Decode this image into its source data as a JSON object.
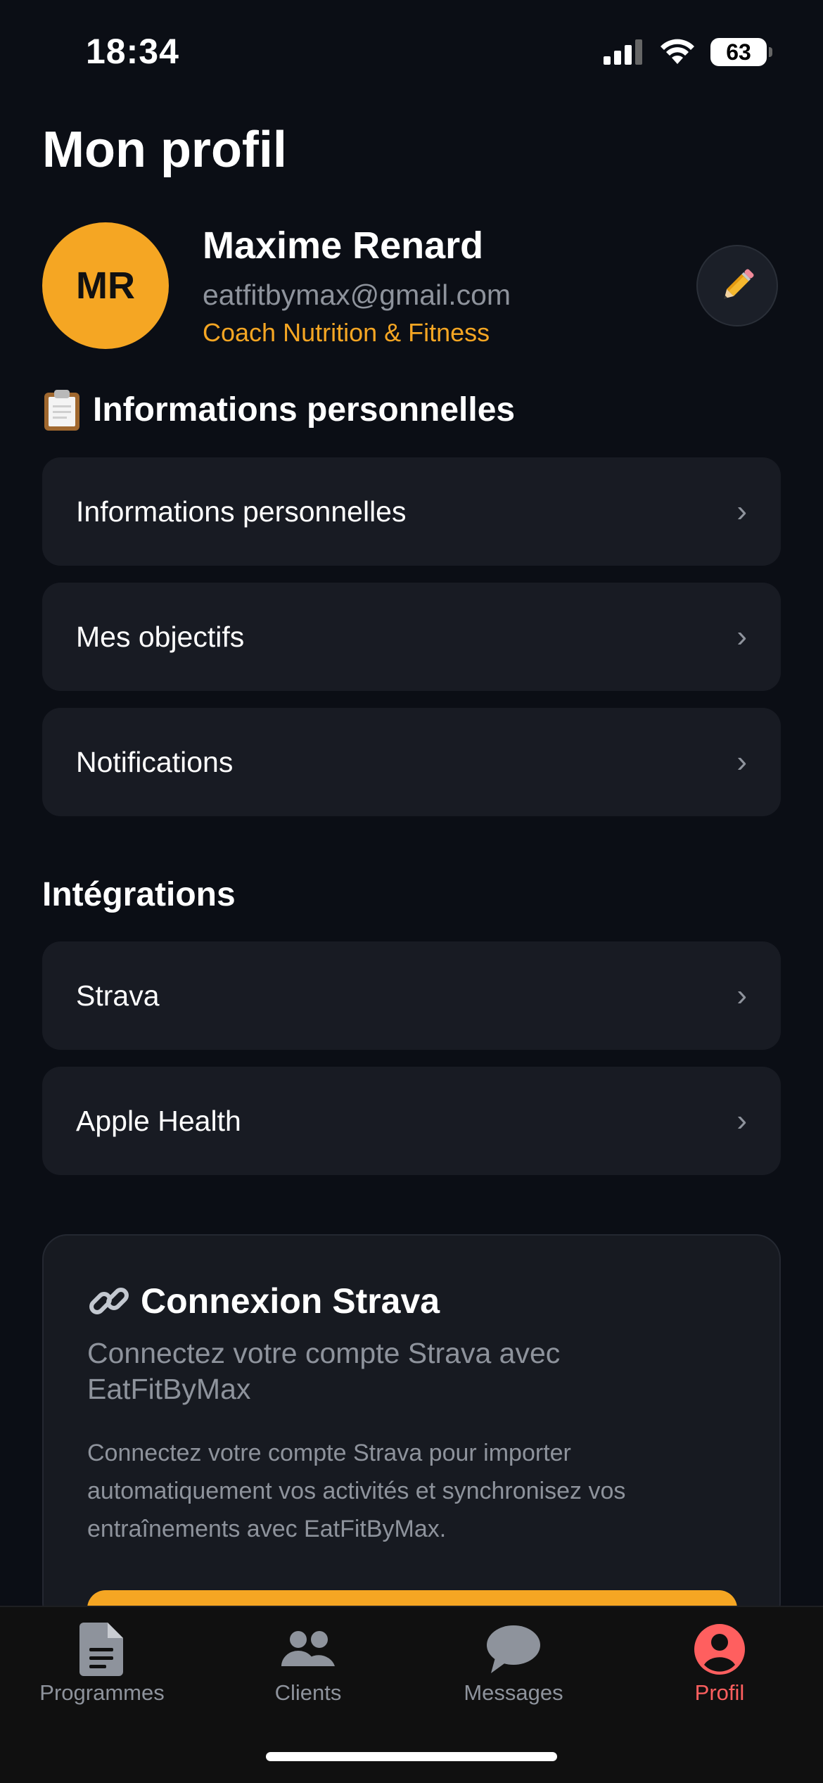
{
  "status": {
    "time": "18:34",
    "battery": "63"
  },
  "header": {
    "title": "Mon profil"
  },
  "profile": {
    "initials": "MR",
    "name": "Maxime Renard",
    "email": "eatfitbymax@gmail.com",
    "role": "Coach Nutrition & Fitness",
    "edit_icon": "pencil-icon"
  },
  "personal_section": {
    "title": "Informations personnelles",
    "icon": "clipboard-icon",
    "items": [
      {
        "label": "Informations personnelles"
      },
      {
        "label": "Mes objectifs"
      },
      {
        "label": "Notifications"
      }
    ]
  },
  "integrations_section": {
    "title": "Intégrations",
    "items": [
      {
        "label": "Strava"
      },
      {
        "label": "Apple Health"
      }
    ]
  },
  "strava_card": {
    "icon": "link-icon",
    "title": "Connexion Strava",
    "subtitle": "Connectez votre compte Strava avec EatFitByMax",
    "description": "Connectez votre compte Strava pour importer automatiquement vos activités et synchronisez vos entraînements avec EatFitByMax."
  },
  "tabbar": {
    "items": [
      {
        "label": "Programmes",
        "icon": "document-icon"
      },
      {
        "label": "Clients",
        "icon": "users-icon"
      },
      {
        "label": "Messages",
        "icon": "chat-bubble-icon"
      },
      {
        "label": "Profil",
        "icon": "profile-icon",
        "active": true
      }
    ]
  },
  "colors": {
    "accent": "#f5a623",
    "active_tab": "#ff5f5f",
    "background": "#0b0e15",
    "card": "#181b23"
  }
}
